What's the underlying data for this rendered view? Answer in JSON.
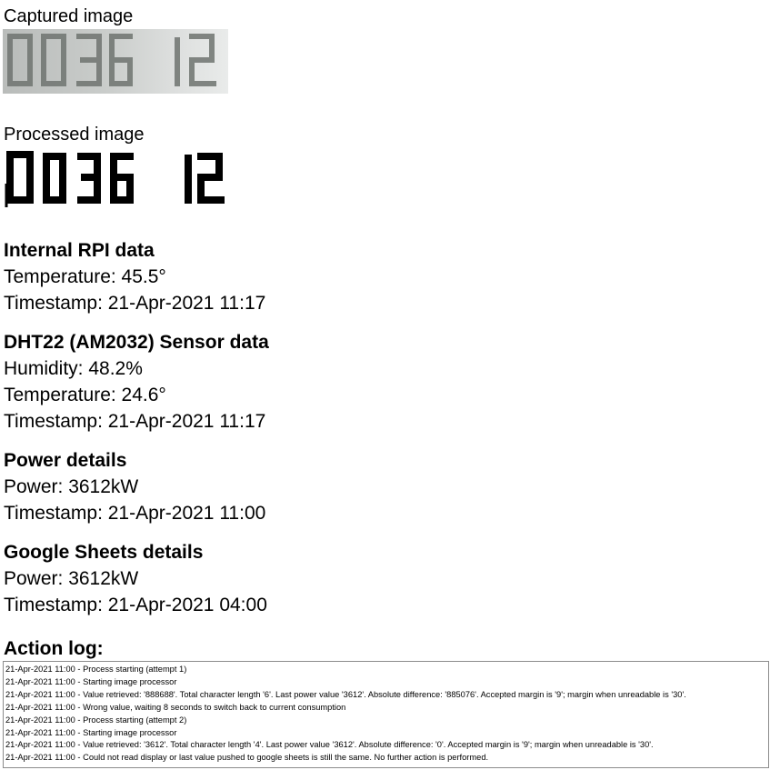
{
  "captured": {
    "title": "Captured image",
    "digits": "0036 12"
  },
  "processed": {
    "title": "Processed image",
    "digits": "0036 12"
  },
  "internal_rpi": {
    "heading": "Internal RPI data",
    "temperature": "Temperature: 45.5°",
    "timestamp": "Timestamp: 21-Apr-2021 11:17"
  },
  "dht22": {
    "heading": "DHT22 (AM2032) Sensor data",
    "humidity": "Humidity: 48.2%",
    "temperature": "Temperature: 24.6°",
    "timestamp": "Timestamp: 21-Apr-2021 11:17"
  },
  "power": {
    "heading": "Power details",
    "power": "Power: 3612kW",
    "timestamp": "Timestamp: 21-Apr-2021 11:00"
  },
  "google_sheets": {
    "heading": "Google Sheets details",
    "power": "Power: 3612kW",
    "timestamp": "Timestamp: 21-Apr-2021 04:00"
  },
  "action_log": {
    "heading": "Action log:",
    "lines": [
      "21-Apr-2021 11:00 - Process starting (attempt 1)",
      "21-Apr-2021 11:00 - Starting image processor",
      "21-Apr-2021 11:00 - Value retrieved: '888688'. Total character length '6'. Last power value '3612'. Absolute difference: '885076'. Accepted margin is '9'; margin when unreadable is '30'.",
      "21-Apr-2021 11:00 - Wrong value, waiting 8 seconds to switch back to current consumption",
      "21-Apr-2021 11:00 - Process starting (attempt 2)",
      "21-Apr-2021 11:00 - Starting image processor",
      "21-Apr-2021 11:00 - Value retrieved: '3612'. Total character length '4'. Last power value '3612'. Absolute difference: '0'. Accepted margin is '9'; margin when unreadable is '30'.",
      "21-Apr-2021 11:00 - Could not read display or last value pushed to google sheets is still the same. No further action is performed."
    ]
  },
  "colors": {
    "captured_digit": "#6f7470",
    "processed_digit": "#000000",
    "log_border": "#8c8c8c"
  }
}
